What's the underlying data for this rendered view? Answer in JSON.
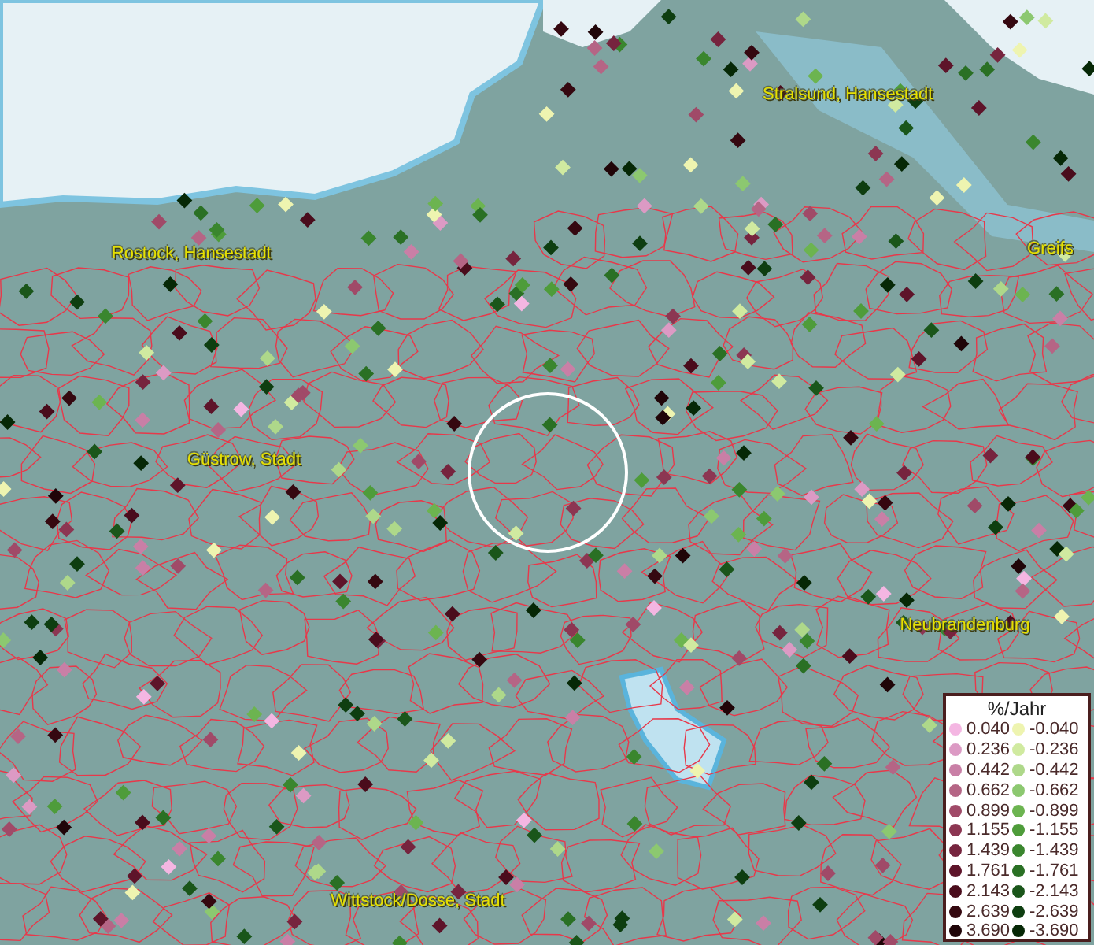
{
  "map": {
    "places": [
      {
        "name": "Stralsund, Hansestadt"
      },
      {
        "name": "Rostock, Hansestadt"
      },
      {
        "name": "Greifs"
      },
      {
        "name": "Güstrow, Stadt"
      },
      {
        "name": "Neubrandenburg"
      },
      {
        "name": "Wittstock/Dosse, Stadt"
      }
    ]
  },
  "legend": {
    "title": "%/Jahr",
    "columns": [
      [
        {
          "value": "0.040",
          "color": "#f4b6e2"
        },
        {
          "value": "0.236",
          "color": "#dc9ac4"
        },
        {
          "value": "0.442",
          "color": "#c97fa6"
        },
        {
          "value": "0.662",
          "color": "#b56585"
        },
        {
          "value": "0.899",
          "color": "#a04a68"
        },
        {
          "value": "1.155",
          "color": "#8c3652"
        },
        {
          "value": "1.439",
          "color": "#76243e"
        },
        {
          "value": "1.761",
          "color": "#5e142a"
        },
        {
          "value": "2.143",
          "color": "#4a0c1c"
        },
        {
          "value": "2.639",
          "color": "#350810"
        },
        {
          "value": "3.690",
          "color": "#200508"
        }
      ],
      [
        {
          "value": "-0.040",
          "color": "#eef4b0"
        },
        {
          "value": "-0.236",
          "color": "#d0eaa0"
        },
        {
          "value": "-0.442",
          "color": "#aed88a"
        },
        {
          "value": "-0.662",
          "color": "#8cc870"
        },
        {
          "value": "-0.899",
          "color": "#6cb450"
        },
        {
          "value": "-1.155",
          "color": "#4e9c3a"
        },
        {
          "value": "-1.439",
          "color": "#3a862e"
        },
        {
          "value": "-1.761",
          "color": "#2a7024"
        },
        {
          "value": "-2.143",
          "color": "#1a561a"
        },
        {
          "value": "-2.639",
          "color": "#0e3e10"
        },
        {
          "value": "-3.690",
          "color": "#062806"
        }
      ]
    ]
  }
}
